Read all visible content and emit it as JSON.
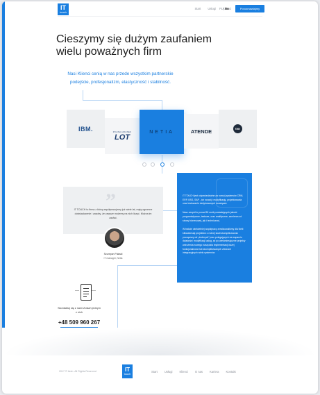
{
  "header": {
    "logo_top": "IT",
    "logo_bottom": "touch",
    "nav": [
      "Start",
      "Usługi",
      "Klienci",
      "O nas",
      "Kariera"
    ],
    "nav_active": "Kariera",
    "lang_pl": "PL",
    "lang_sep": " | ",
    "lang_en": "En",
    "cta": "Porozmawiajmy"
  },
  "hero": {
    "title": "Cieszymy się dużym zaufaniem wielu poważnych firm",
    "lead": "Nasi Klienci cenią w nas przede wszystkim partnerskie podejście, profesjonalizm, elastyczność i stabilność."
  },
  "clients": {
    "logos": [
      "IBM.",
      "LOT",
      "NETIA",
      "ATENDE",
      "tvn"
    ],
    "lot_caption": "POLISH AIRLINES"
  },
  "quote": {
    "mark": "”",
    "text": "IT TOUCH to firma z którą współpracujemy już wiele lat, mają ogromne doświadczenie i zasoby, że zawsze możemy na nich liczyć. Można im zaufać.",
    "name": "Szczepan Pułaski",
    "role": "IT manager, Netia"
  },
  "panel": {
    "paragraphs": [
      "IT TOUCH jest odpowiedzialne za rozwój systemów CRM, ERP, BSS, SAP - ich rozwój i modyfikację, projektowania oraz testowanie dedykowanych rozwiązań.",
      "Nasz zespół to ponad 50 osób posiadających jakość programistyczne, testowe, oraz analityczne, zamierza od strony biznesowej, jak i technicznej.",
      "W trakcie wieloletniej współpracy zrealizowaliśmy dla Netii kilkadziesiąt projektów o różnej skali skomplikowania: począwszy od „drobnych” prac polegających na wsparciu działania i modyfikacji usług, aż po wielomiesięczne projekty wdrożenia nowego narzędzia implementacji dużej funkcjonalności lub skomplikowanych zbiorach integracyjnych wielu systemów."
    ]
  },
  "contact": {
    "text": "Skontaktuj się z nami Zostań jednym z nich",
    "phone": "+48 509 960 267",
    "up": "▲"
  },
  "footer": {
    "copyright": "2017 © Itech. All Rights Reserved",
    "logo_top": "IT",
    "logo_bottom": "touch",
    "nav": [
      "Start",
      "Usługi",
      "Klienci",
      "O nas",
      "Kariera",
      "Kontakt"
    ]
  },
  "colors": {
    "accent": "#1a7fe0",
    "light_bg": "#eef0f2"
  }
}
